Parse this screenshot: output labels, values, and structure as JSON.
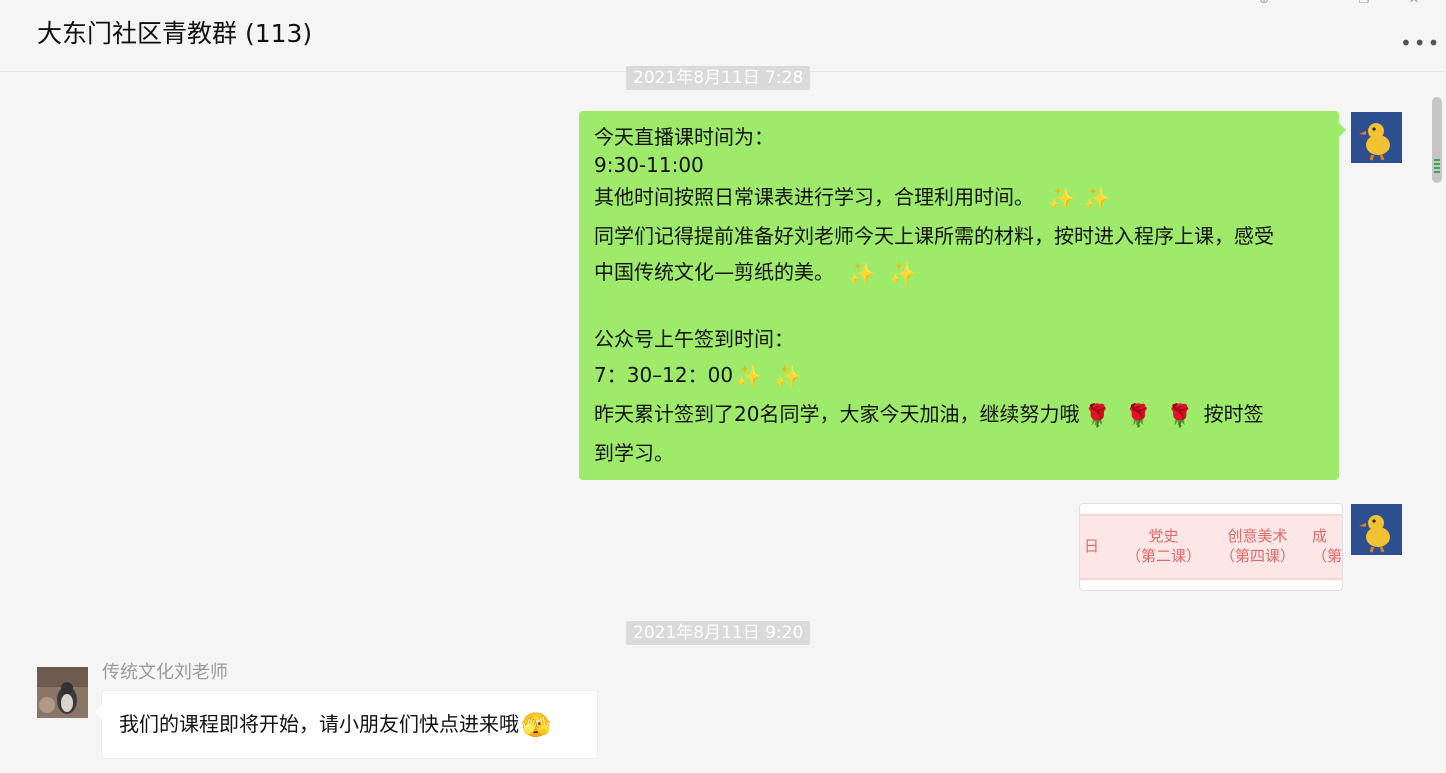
{
  "header": {
    "title": "大东门社区青教群 (113)",
    "more_label": "•••"
  },
  "window_controls": {
    "pin": "⊕",
    "minimize": "—",
    "maximize": "❐",
    "close": "✕"
  },
  "chat": {
    "timestamp_1": "2021年8月11日 7:28",
    "timestamp_2": "2021年8月11日 9:20",
    "announcement": {
      "line_1": "今天直播课时间为：",
      "line_2": "9:30-11:00",
      "line_3": "其他时间按照日常课表进行学习，合理利用时间。",
      "line_4": "同学们记得提前准备好刘老师今天上课所需的材料，按时进入程序上课，感受",
      "line_5": "中国传统文化—剪纸的美。",
      "line_6": "公众号上午签到时间：",
      "line_7": "7：30–12：00",
      "line_8": "昨天累计签到了20名同学，大家今天加油，继续努力哦",
      "line_8_tail": "按时签",
      "line_9": "到学习。",
      "sparkle": "✨",
      "rose": "🌹"
    },
    "image_message": {
      "col_1": "日",
      "col_2_top": "党史",
      "col_2_bottom": "（第二课）",
      "col_3_top": "创意美术",
      "col_3_bottom": "（第四课）",
      "col_4_top": "成",
      "col_4_bottom": "（第"
    },
    "incoming": {
      "sender": "传统文化刘老师",
      "text": "我们的课程即将开始，请小朋友们快点进来哦",
      "emoji": "🫣"
    }
  },
  "colors": {
    "outgoing_bubble": "#9eea6a",
    "incoming_bubble": "#ffffff",
    "background": "#f5f5f5",
    "timestamp_bg": "#dadada"
  }
}
